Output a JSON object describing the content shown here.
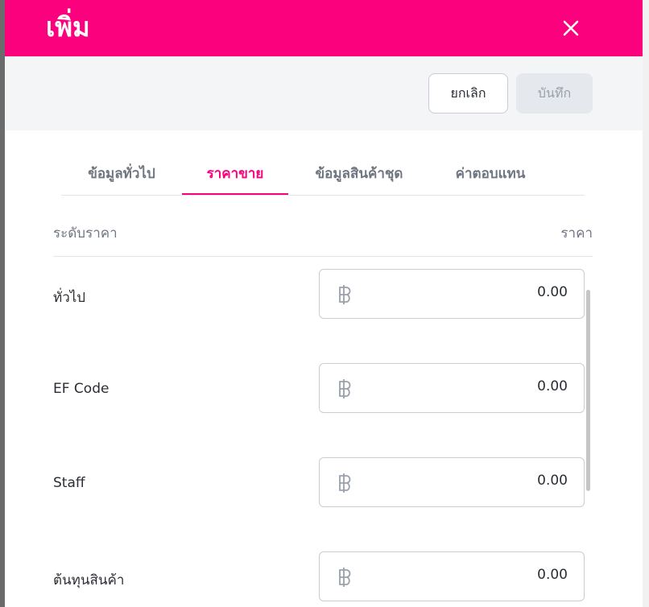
{
  "dialog": {
    "title": "เพิ่ม",
    "close_icon": "close-icon"
  },
  "actions": {
    "cancel_label": "ยกเลิก",
    "save_label": "บันทึก"
  },
  "tabs": [
    {
      "label": "ข้อมูลทั่วไป",
      "active": false
    },
    {
      "label": "ราคาขาย",
      "active": true
    },
    {
      "label": "ข้อมูลสินค้าชุด",
      "active": false
    },
    {
      "label": "ค่าตอบแทน",
      "active": false
    }
  ],
  "price_table": {
    "header_level": "ระดับราคา",
    "header_price": "ราคา",
    "currency_icon": "baht-icon",
    "rows": [
      {
        "label": "ทั่วไป",
        "value": "0.00"
      },
      {
        "label": "EF Code",
        "value": "0.00"
      },
      {
        "label": "Staff",
        "value": "0.00"
      },
      {
        "label": "ต้นทุนสินค้า",
        "value": "0.00"
      }
    ]
  },
  "colors": {
    "accent": "#fb017e",
    "action_bar": "#f4f5f7",
    "text": "#2a2e34",
    "muted_text": "#6f7682"
  }
}
